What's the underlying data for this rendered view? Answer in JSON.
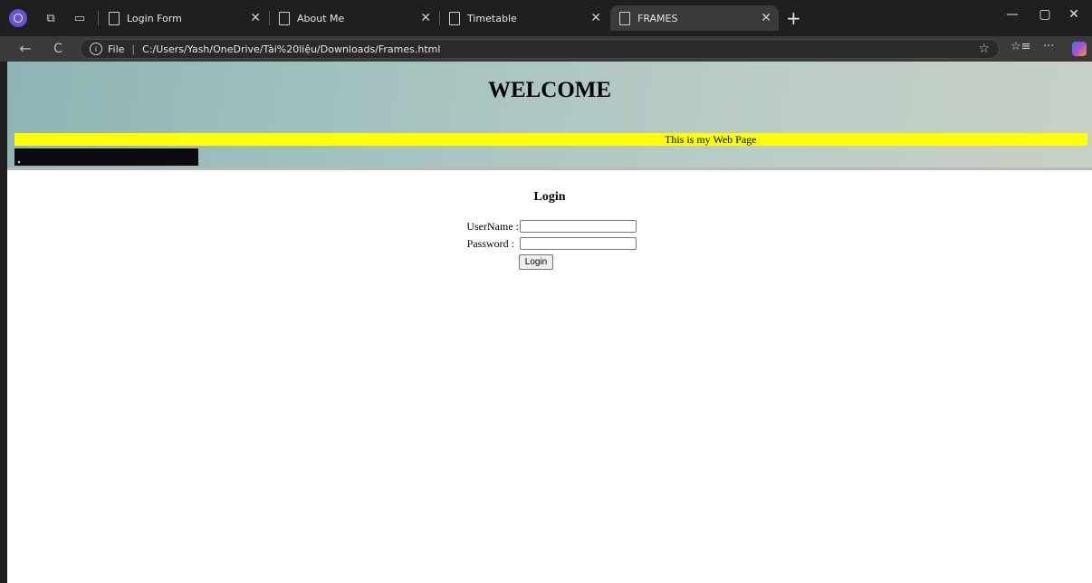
{
  "browser": {
    "tabs": [
      {
        "label": "Login Form",
        "active": false
      },
      {
        "label": "About Me",
        "active": false
      },
      {
        "label": "Timetable",
        "active": false
      },
      {
        "label": "FRAMES",
        "active": true
      }
    ],
    "new_tab_glyph": "+",
    "window": {
      "minimize": "—",
      "maximize": "▢",
      "close": "✕"
    },
    "address": {
      "scheme_label": "File",
      "url": "C:/Users/Yash/OneDrive/Tài%20liệu/Downloads/Frames.html"
    },
    "icons": {
      "back": "←",
      "refresh": "C",
      "info": "i",
      "star": "☆",
      "favorites": "☆≡",
      "more": "···"
    }
  },
  "page": {
    "header": {
      "title": "WELCOME",
      "marquee": "This is my Web Page"
    },
    "login": {
      "heading": "Login",
      "username_label": "UserName :",
      "password_label": "Password :",
      "submit_label": "Login"
    }
  },
  "colors": {
    "marquee_bg": "#ffff00",
    "banner_bg": "#a4c3c0",
    "browser_chrome": "#1f1f1f"
  }
}
